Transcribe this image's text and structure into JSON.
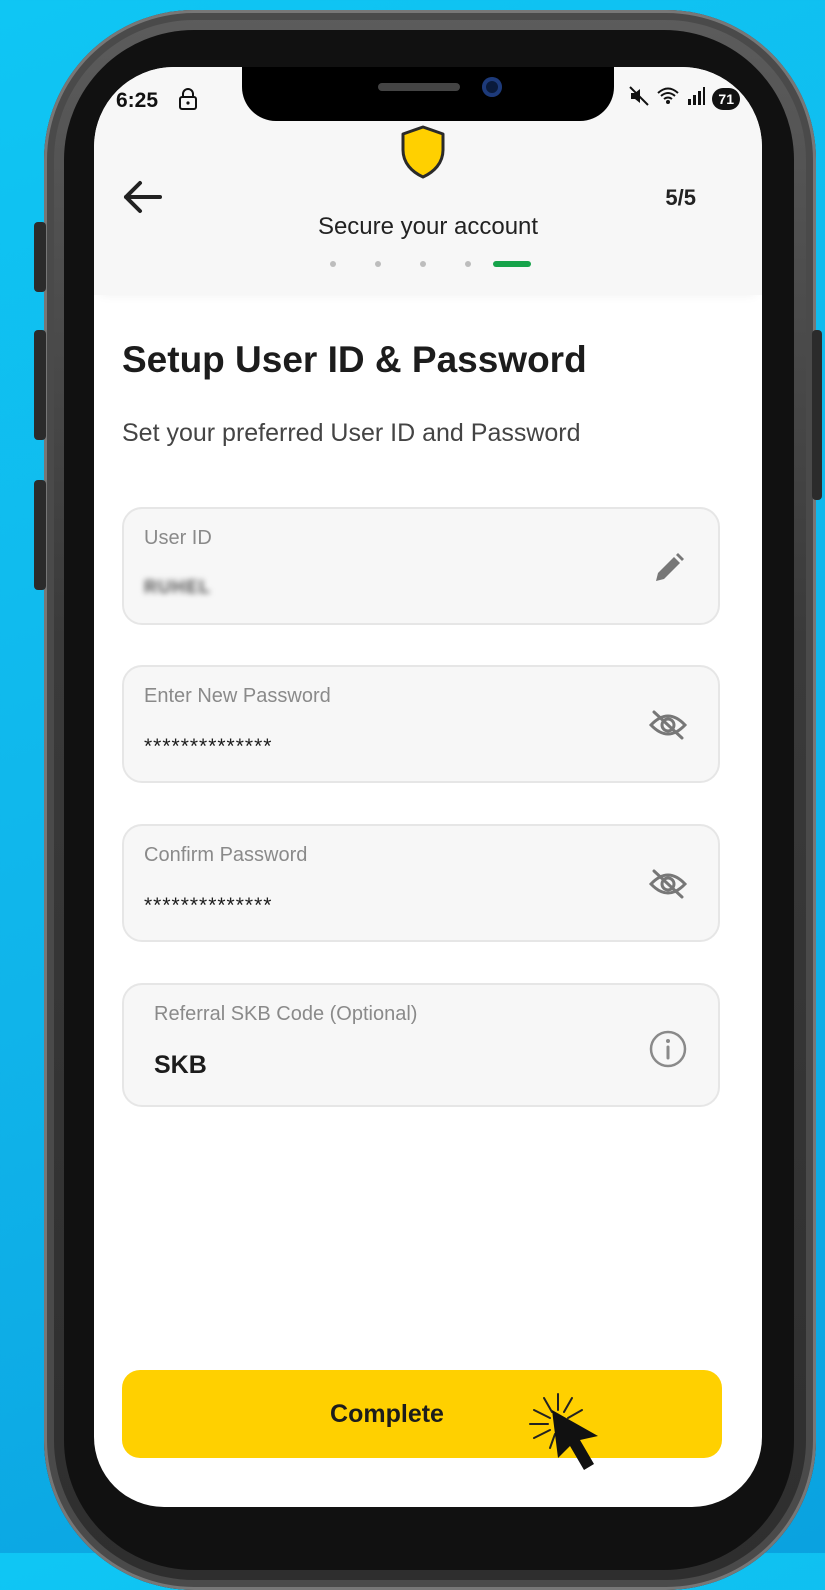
{
  "status_bar": {
    "time": "6:25",
    "battery": "71"
  },
  "header": {
    "title": "Secure your account",
    "step": "5/5",
    "steps_total": 5,
    "steps_current": 5
  },
  "page": {
    "title": "Setup User ID & Password",
    "subtitle": "Set your preferred User ID and Password"
  },
  "form": {
    "user_id": {
      "label": "User ID",
      "value": "RUHEL"
    },
    "new_password": {
      "label": "Enter New Password",
      "value": "**************"
    },
    "confirm_password": {
      "label": "Confirm Password",
      "value": "**************"
    },
    "referral": {
      "label": "Referral SKB Code (Optional)",
      "value": "SKB"
    }
  },
  "actions": {
    "complete_label": "Complete"
  },
  "colors": {
    "background": "#10b4ea",
    "accent": "#ffd000",
    "step_active": "#16a34a",
    "field_bg": "#f7f7f7"
  }
}
